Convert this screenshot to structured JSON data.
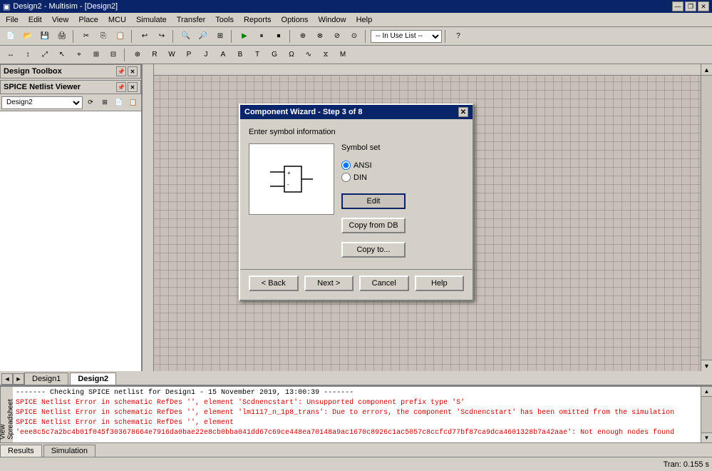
{
  "titlebar": {
    "title": "Design2 - Multisim - [Design2]",
    "btn_minimize": "—",
    "btn_restore": "❐",
    "btn_close": "✕",
    "btn_inner_restore": "❐",
    "btn_inner_close": "✕"
  },
  "menubar": {
    "items": [
      "File",
      "Edit",
      "View",
      "Place",
      "MCU",
      "Simulate",
      "Transfer",
      "Tools",
      "Reports",
      "Options",
      "Window",
      "Help"
    ]
  },
  "toolbar": {
    "combo_label": "-- In Use List --"
  },
  "left_panel": {
    "design_toolbox_label": "Design Toolbox",
    "spice_netlist_label": "SPICE Netlist Viewer",
    "dropdown_value": "Design2"
  },
  "tabs": {
    "items": [
      "Design1",
      "Design2"
    ]
  },
  "dialog": {
    "title": "Component Wizard - Step 3 of 8",
    "instruction": "Enter symbol information",
    "symbol_set_label": "Symbol set",
    "radio_ansi": "ANSI",
    "radio_din": "DIN",
    "btn_edit": "Edit",
    "btn_copy_from_db": "Copy from DB",
    "btn_copy_to": "Copy to...",
    "btn_back": "< Back",
    "btn_next": "Next >",
    "btn_cancel": "Cancel",
    "btn_help": "Help"
  },
  "log": {
    "side_label": "Spreadsheet View",
    "lines": [
      {
        "text": "------- Checking SPICE netlist for Design1 - 15 November 2019, 13:00:39 -------",
        "type": "normal"
      },
      {
        "text": "SPICE Netlist Error in schematic RefDes '', element 'Scdnencstart': Unsupported component prefix type 'S'",
        "type": "error"
      },
      {
        "text": "SPICE Netlist Error in schematic RefDes '', element 'lm1117_n_1p8_trans': Due to errors, the component 'Scdnencstart' has been omitted from the simulation",
        "type": "error"
      },
      {
        "text": "SPICE Netlist Error in schematic RefDes '', element 'eee8c5c7a2bc4b01f045f303678664e7916da0bae22e8cb0bba041dd67c69ce448ea70148a9ac1670c8926c1ac5057c8ccfcd77bf87ca9dca4601328b7a42aae': Not enough nodes found",
        "type": "error"
      }
    ]
  },
  "bottom_tabs": {
    "items": [
      {
        "label": "Results",
        "active": true
      },
      {
        "label": "Simulation",
        "active": false
      }
    ]
  },
  "status_bar": {
    "left_text": "",
    "right_text": "Tran: 0.155 s"
  }
}
